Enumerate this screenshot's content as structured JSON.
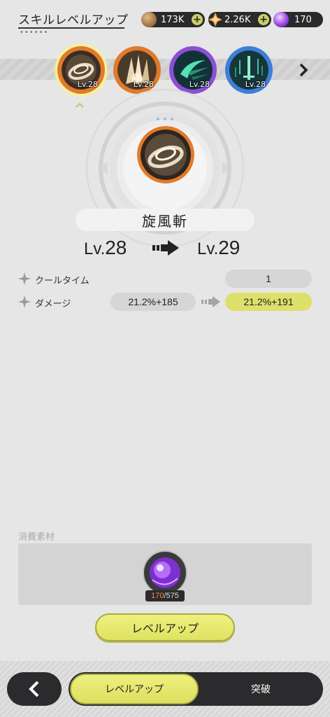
{
  "header": {
    "title": "スキルレベルアップ",
    "currencies": [
      {
        "name": "gold",
        "icon": "gold-coin-icon",
        "value": "173K",
        "plus": "+"
      },
      {
        "name": "gem",
        "icon": "star-crystal-icon",
        "value": "2.26K",
        "plus": "+"
      },
      {
        "name": "skill-orb",
        "icon": "purple-orb-icon",
        "value": "170"
      }
    ]
  },
  "skill_tabs": [
    {
      "level": "Lv.28",
      "icon": "whirlwind-slash-icon",
      "ring_color": "#e07a2a",
      "selected": true
    },
    {
      "level": "Lv.28",
      "icon": "crystal-burst-icon",
      "ring_color": "#e07a2a",
      "selected": false
    },
    {
      "level": "Lv.28",
      "icon": "crescent-wave-icon",
      "ring_color": "#8b4fd6",
      "selected": false
    },
    {
      "level": "Lv.28",
      "icon": "sword-rain-icon",
      "ring_color": "#3d7fd8",
      "selected": false
    }
  ],
  "skill": {
    "name": "旋風斬",
    "level_prefix": "Lv.",
    "level_from": "28",
    "level_to": "29"
  },
  "stats": [
    {
      "label": "クールタイム",
      "current": "1",
      "next": ""
    },
    {
      "label": "ダメージ",
      "current": "21.2%+185",
      "next": "21.2%+191"
    }
  ],
  "materials": {
    "label": "消費素材",
    "item_icon": "purple-orb-icon",
    "have": "170",
    "separator": "/",
    "need": "575"
  },
  "levelup_button": "レベルアップ",
  "bottom_tabs": {
    "active": "レベルアップ",
    "inactive": "突破"
  },
  "colors": {
    "accent_yellow": "#e4e76a",
    "dark": "#2b2b2d",
    "shortfall_orange": "#ff8a3a"
  }
}
